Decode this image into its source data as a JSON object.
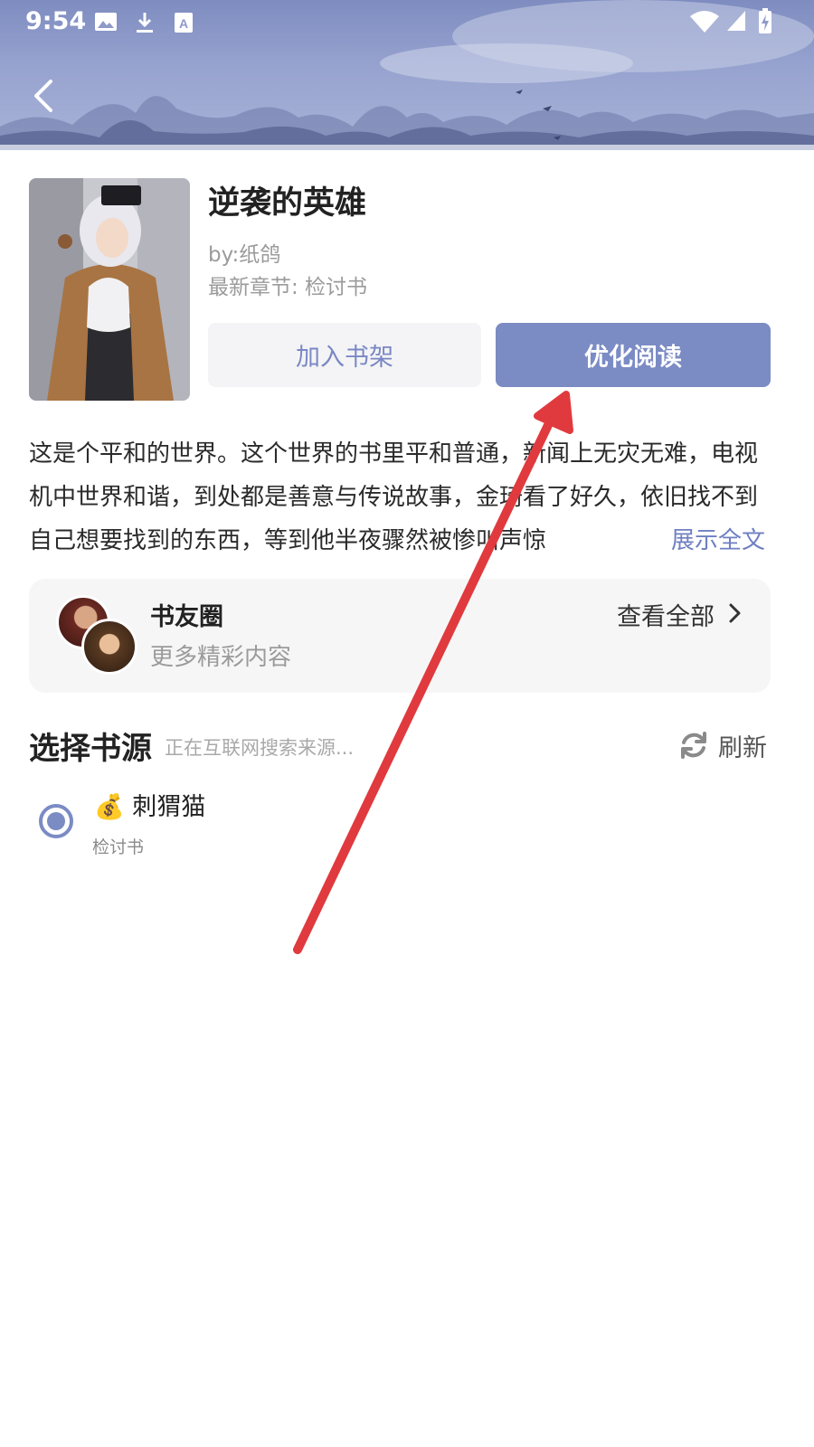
{
  "status_bar": {
    "time": "9:54",
    "left_icons": [
      "image-icon",
      "download-icon",
      "font-icon"
    ],
    "right_icons": [
      "wifi-icon",
      "signal-icon",
      "battery-icon"
    ]
  },
  "header": {
    "back_icon": "back-arrow-icon"
  },
  "book": {
    "title": "逆袭的英雄",
    "author": "by:纸鸽",
    "latest_chapter": "最新章节: 检讨书",
    "add_shelf_label": "加入书架",
    "optimize_read_label": "优化阅读"
  },
  "intro": {
    "text": "这是个平和的世界。这个世界的书里平和普通，新闻上无灾无难，电视机中世界和谐，到处都是善意与传说故事，金琦看了好久，依旧找不到自己想要找到的东西，等到他半夜骤然被惨叫声惊",
    "show_all_label": "展示全文"
  },
  "circle": {
    "title": "书友圈",
    "subtitle": "更多精彩内容",
    "view_all_label": "查看全部"
  },
  "sources": {
    "heading": "选择书源",
    "status": "正在互联网搜索来源...",
    "refresh_label": "刷新",
    "items": [
      {
        "icon": "money-bag-emoji",
        "emoji": "💰",
        "name": "刺猬猫",
        "chapter": "检讨书",
        "selected": true
      }
    ]
  },
  "colors": {
    "accent": "#7b8bc4",
    "link": "#6f7fc2",
    "annotation_arrow": "#e03a3e"
  }
}
